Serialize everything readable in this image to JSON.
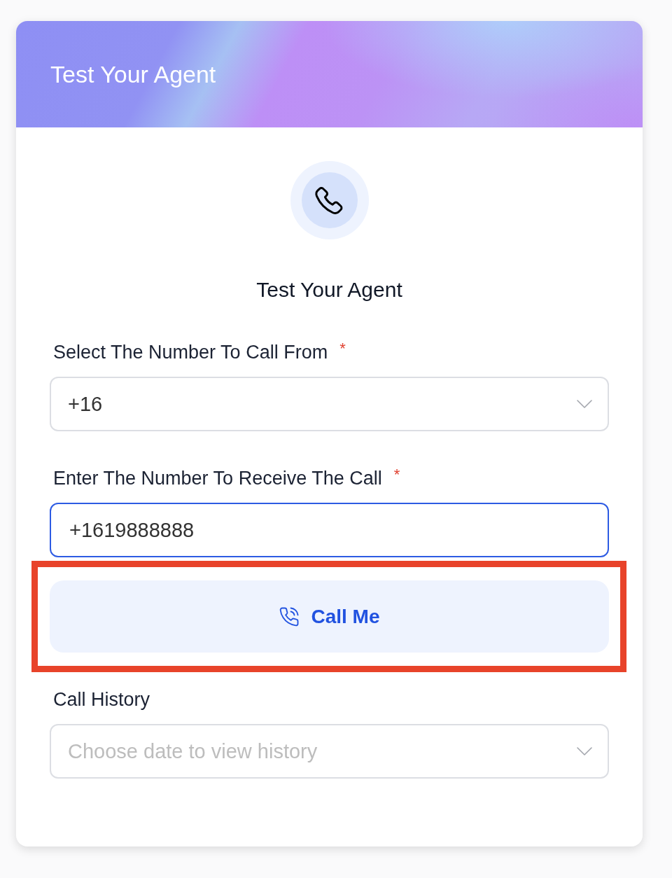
{
  "header": {
    "title": "Test Your Agent"
  },
  "hero": {
    "title": "Test Your Agent"
  },
  "fields": [
    {
      "kind": "select",
      "label": "Select The Number To Call From",
      "required_mark": "*",
      "value": "+16",
      "focused": false
    },
    {
      "kind": "input",
      "label": "Enter The Number To Receive The Call",
      "required_mark": "*",
      "value": "+1619888888",
      "focused": true
    }
  ],
  "call_button": {
    "label": "Call Me",
    "highlighted": true
  },
  "history": {
    "kind": "select",
    "label": "Call History",
    "placeholder": "Choose date to view history",
    "focused": false
  }
}
